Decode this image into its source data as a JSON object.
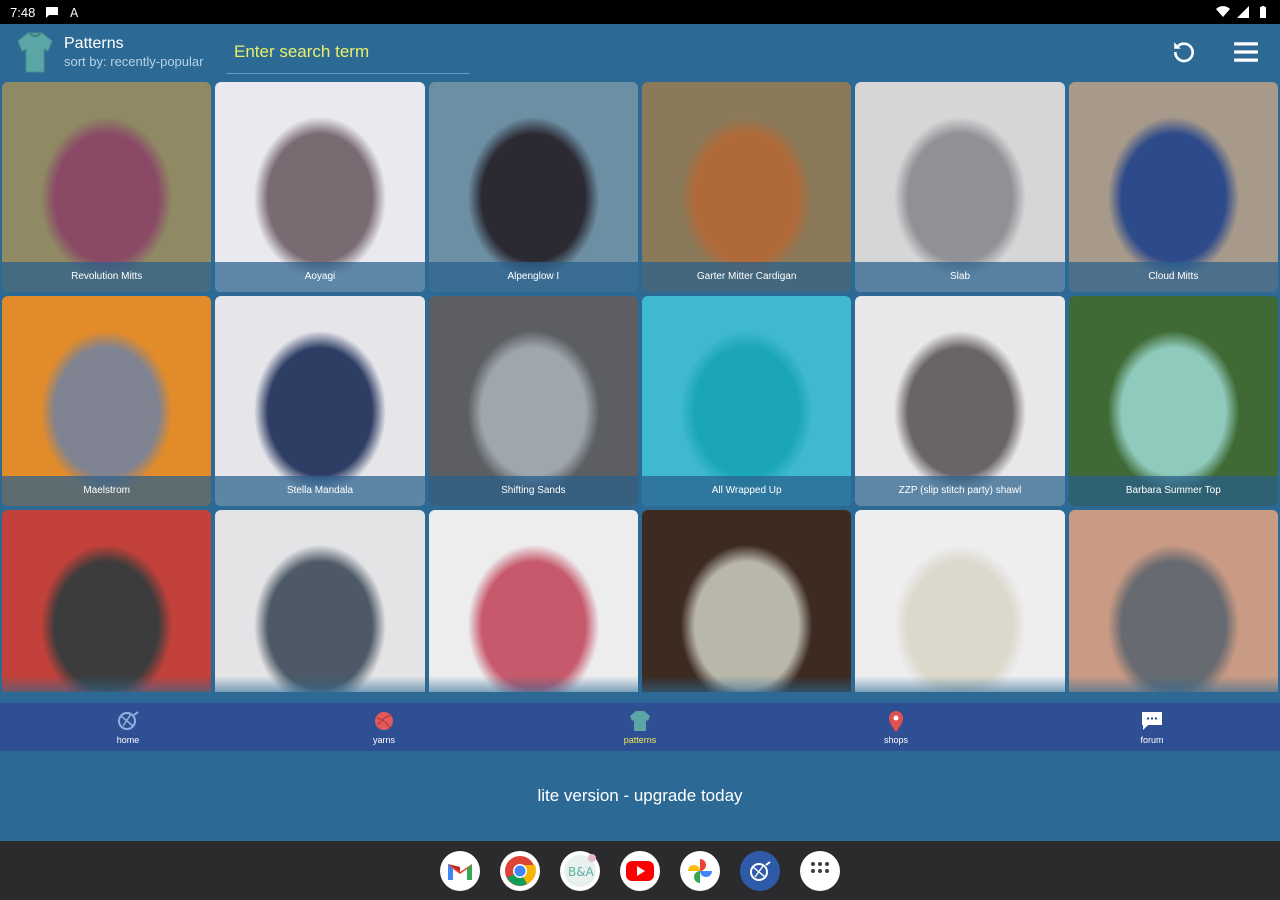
{
  "status_bar": {
    "time": "7:48"
  },
  "app_bar": {
    "title": "Patterns",
    "subtitle": "sort by: recently-popular",
    "search_placeholder": "Enter search term"
  },
  "patterns": [
    {
      "name": "Revolution Mitts",
      "colors": [
        "#8f8a64",
        "#8a4a66"
      ]
    },
    {
      "name": "Aoyagi",
      "colors": [
        "#e9e9ef",
        "#7a6a72"
      ]
    },
    {
      "name": "Alpenglow I",
      "colors": [
        "#6d8fa4",
        "#2b2a33"
      ]
    },
    {
      "name": "Garter Mitter Cardigan",
      "colors": [
        "#8a7a5a",
        "#b06a3a"
      ]
    },
    {
      "name": "Slab",
      "colors": [
        "#d6d6d6",
        "#8f9196"
      ]
    },
    {
      "name": "Cloud Mitts",
      "colors": [
        "#a89a8a",
        "#2d4a8a"
      ]
    },
    {
      "name": "Maelstrom",
      "colors": [
        "#e28b2a",
        "#7f8392"
      ]
    },
    {
      "name": "Stella Mandala",
      "colors": [
        "#e6e6ea",
        "#2e3d64"
      ]
    },
    {
      "name": "Shifting Sands",
      "colors": [
        "#5c5e62",
        "#9fa7ae"
      ]
    },
    {
      "name": "All Wrapped Up",
      "colors": [
        "#3fb8d0",
        "#1aa6b4"
      ]
    },
    {
      "name": "ZZP (slip stitch party) shawl",
      "colors": [
        "#e8e8ea",
        "#6a6468"
      ]
    },
    {
      "name": "Barbara Summer Top",
      "colors": [
        "#3f6a35",
        "#8fcabc"
      ]
    },
    {
      "name": "",
      "colors": [
        "#c2413a",
        "#3c3c3c"
      ]
    },
    {
      "name": "",
      "colors": [
        "#e4e4e6",
        "#4d5966"
      ]
    },
    {
      "name": "",
      "colors": [
        "#ededee",
        "#c7596c"
      ]
    },
    {
      "name": "",
      "colors": [
        "#3d2b22",
        "#b9b6aa"
      ]
    },
    {
      "name": "",
      "colors": [
        "#eeeeef",
        "#ddd8cc"
      ]
    },
    {
      "name": "",
      "colors": [
        "#c99a84",
        "#676a70"
      ]
    }
  ],
  "bottom_nav": [
    {
      "label": "home",
      "icon": "yarn-ball-logo-icon",
      "color": "#8fb3e0"
    },
    {
      "label": "yarns",
      "icon": "yarn-ball-icon",
      "color": "#e45a5a"
    },
    {
      "label": "patterns",
      "icon": "sweater-icon",
      "color": "#5aa6a6"
    },
    {
      "label": "shops",
      "icon": "map-pin-icon",
      "color": "#e05050"
    },
    {
      "label": "forum",
      "icon": "chat-bubble-icon",
      "color": "#ffffff"
    }
  ],
  "banner": {
    "text": "lite version - upgrade today"
  },
  "dock": [
    {
      "app": "gmail",
      "icon": "gmail-icon"
    },
    {
      "app": "chrome",
      "icon": "chrome-icon"
    },
    {
      "app": "blog",
      "icon": "blog-app-icon"
    },
    {
      "app": "youtube",
      "icon": "youtube-icon"
    },
    {
      "app": "photos",
      "icon": "photos-icon"
    },
    {
      "app": "yarn app",
      "icon": "yarn-app-icon"
    },
    {
      "app": "app drawer",
      "icon": "app-drawer-icon"
    }
  ],
  "colors": {
    "app_bar": "#2c6a95",
    "bottom_nav": "#2e4f93",
    "accent_yellow": "#e9ef6a",
    "active_nav": "#f2e35a"
  }
}
